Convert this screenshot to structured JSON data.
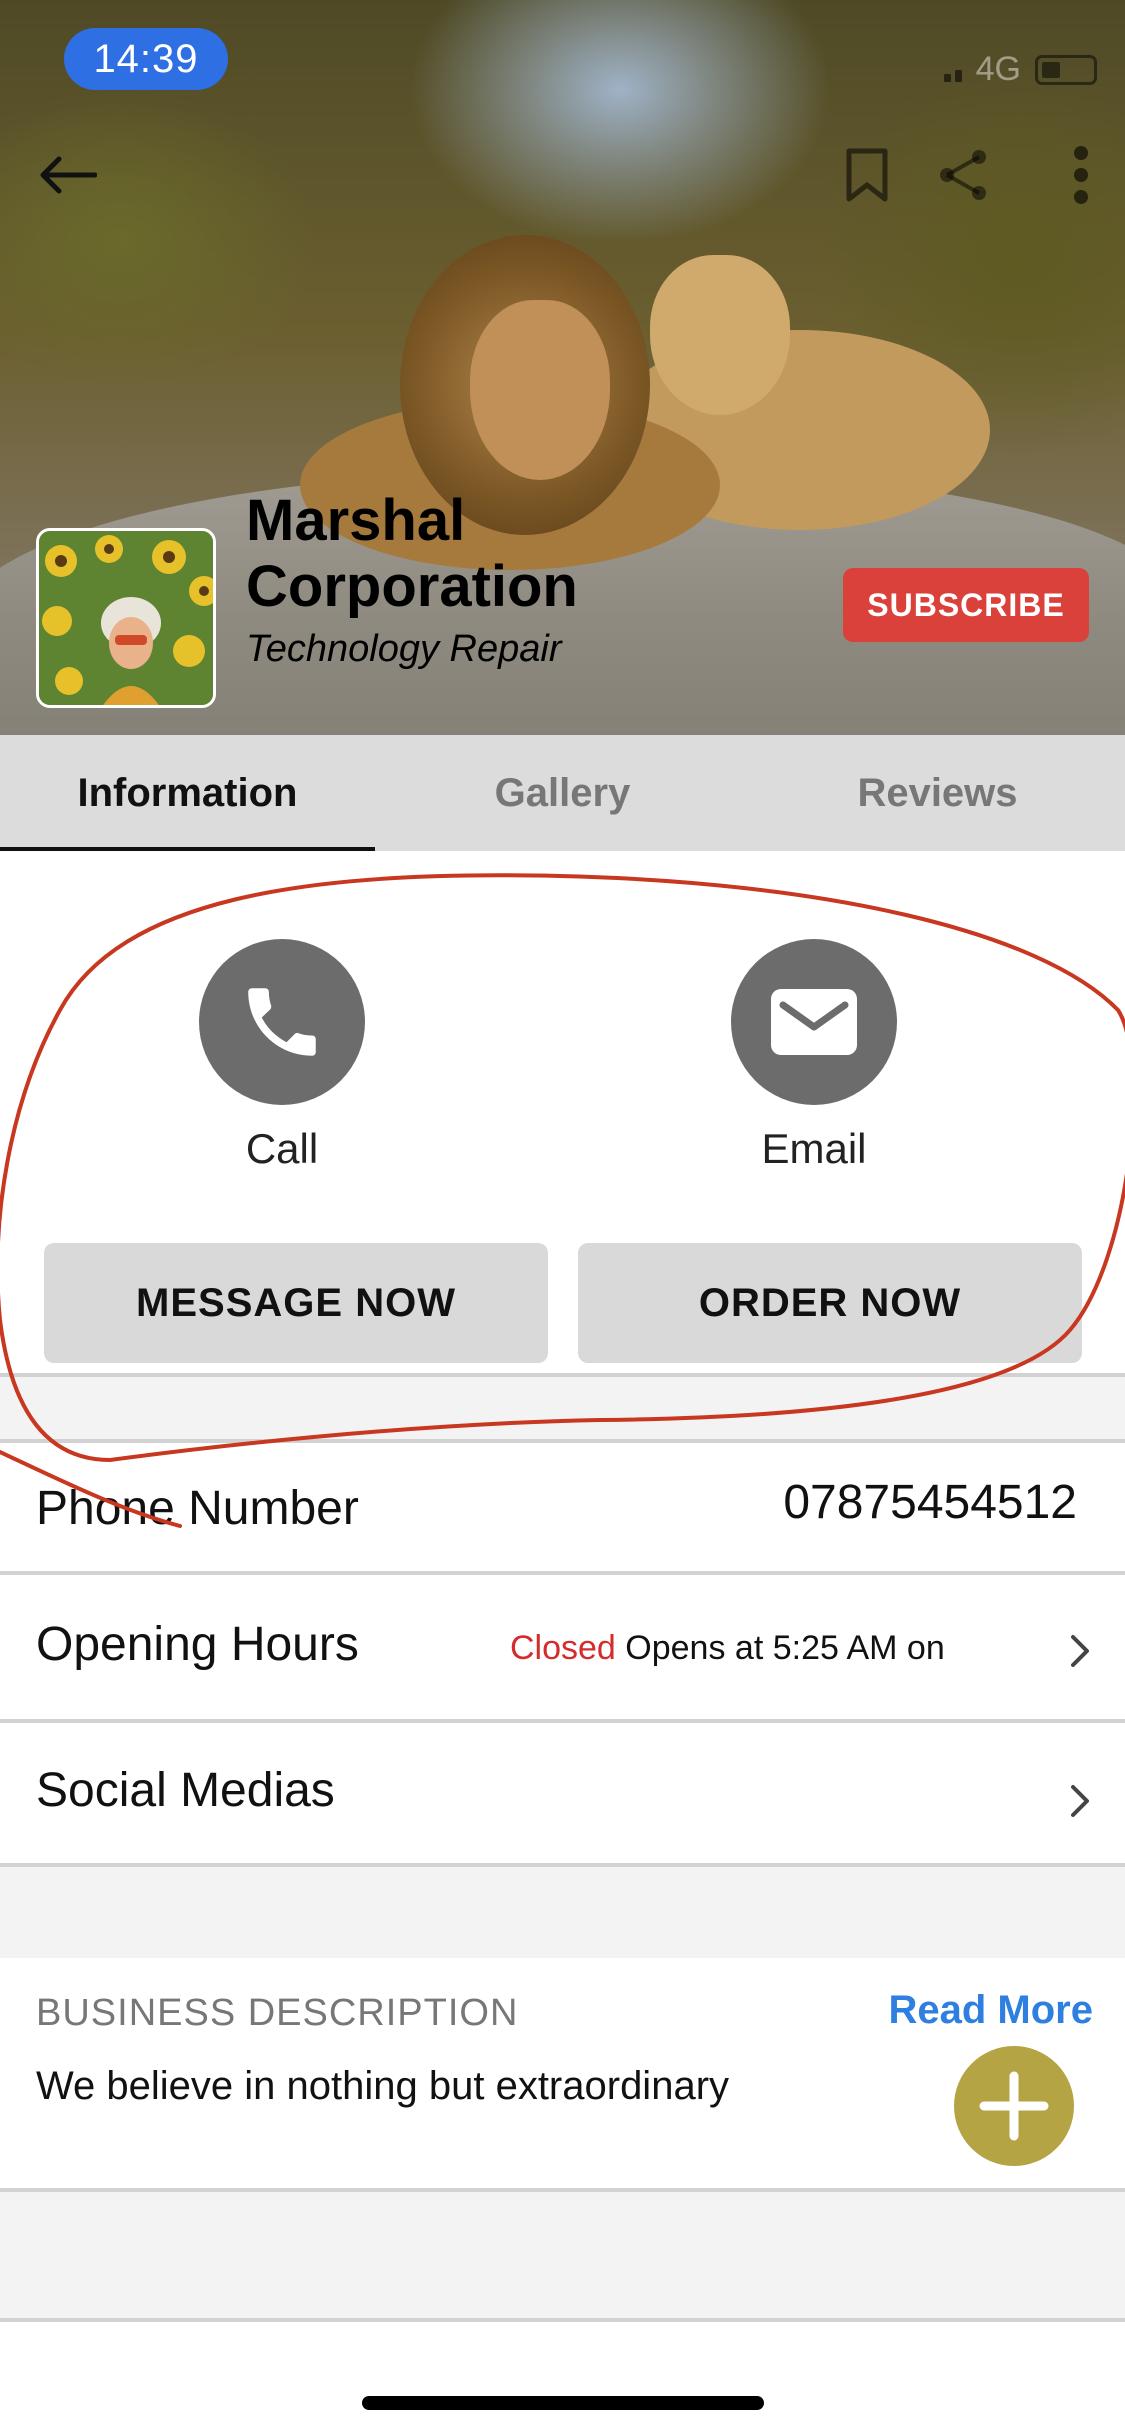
{
  "status_bar": {
    "time": "14:39",
    "network": "4G"
  },
  "header": {
    "icons": [
      "back-arrow-icon",
      "bookmark-icon",
      "share-icon",
      "more-vertical-icon"
    ]
  },
  "profile": {
    "name": "Marshal Corporation",
    "category": "Technology Repair",
    "subscribe_label": "SUBSCRIBE"
  },
  "tabs": [
    {
      "label": "Information",
      "active": true
    },
    {
      "label": "Gallery",
      "active": false
    },
    {
      "label": "Reviews",
      "active": false
    }
  ],
  "actions": {
    "call_label": "Call",
    "email_label": "Email",
    "message_button": "MESSAGE NOW",
    "order_button": "ORDER NOW"
  },
  "info_rows": {
    "phone": {
      "label": "Phone Number",
      "value": "07875454512"
    },
    "hours": {
      "label": "Opening Hours",
      "status": "Closed",
      "detail": "Opens at 5:25 AM on"
    },
    "social": {
      "label": "Social Medias"
    }
  },
  "description": {
    "title": "BUSINESS DESCRIPTION",
    "read_more": "Read More",
    "text": "We believe in nothing but extraordinary"
  },
  "colors": {
    "accent_blue": "#2f7fe0",
    "subscribe_red": "#d9413a",
    "closed_red": "#d52b2b",
    "fab_gold": "#b5a444",
    "annotation_red": "#c8371f"
  }
}
